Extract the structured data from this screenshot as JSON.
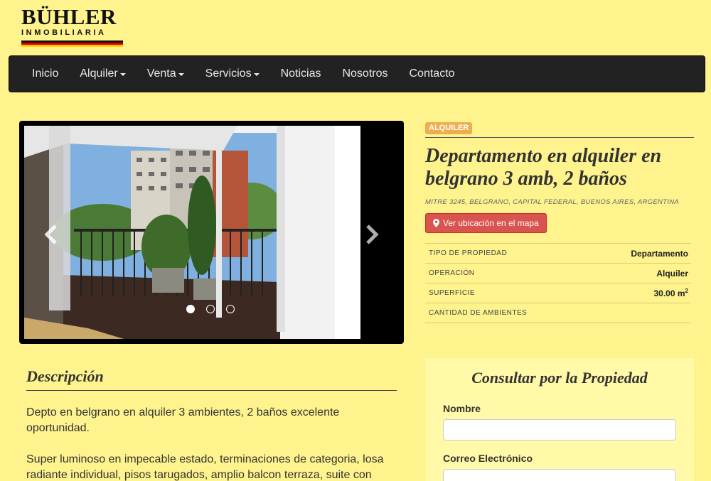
{
  "brand": {
    "name": "BÜHLER",
    "subtitle": "INMOBILIARIA",
    "flag_colors": [
      "#111111",
      "#dd0000",
      "#ffce00"
    ]
  },
  "nav": {
    "items": [
      {
        "label": "Inicio",
        "dropdown": false
      },
      {
        "label": "Alquiler",
        "dropdown": true
      },
      {
        "label": "Venta",
        "dropdown": true
      },
      {
        "label": "Servicios",
        "dropdown": true
      },
      {
        "label": "Noticias",
        "dropdown": false
      },
      {
        "label": "Nosotros",
        "dropdown": false
      },
      {
        "label": "Contacto",
        "dropdown": false
      }
    ]
  },
  "carousel": {
    "prev_icon": "chevron-left-icon",
    "next_icon": "chevron-right-icon",
    "slide_count": 3,
    "active_slide": 1
  },
  "property": {
    "badge": "ALQUILER",
    "title": "Departamento en alquiler en belgrano 3 amb, 2 baños",
    "address": "MITRE 3245, BELGRANO, CAPITAL FEDERAL, BUENOS AIRES, ARGENTINA",
    "map_button": "Ver ubicación en el mapa",
    "details": [
      {
        "key": "TIPO DE PROPIEDAD",
        "value": "Departamento"
      },
      {
        "key": "OPERACIÓN",
        "value": "Alquiler"
      },
      {
        "key": "SUPERFICIE",
        "value": "30.00 m²"
      },
      {
        "key": "CANTIDAD DE AMBIENTES",
        "value": ""
      }
    ]
  },
  "description": {
    "title": "Descripción",
    "paragraphs": [
      "Depto en belgrano en alquiler 3 ambientes, 2 baños excelente oportunidad.",
      "Super luminoso en impecable estado, terminaciones de categoria, losa radiante individual, pisos tarugados, amplio balcon terraza, suite con"
    ]
  },
  "contact_form": {
    "title": "Consultar por la Propiedad",
    "fields": [
      {
        "label": "Nombre",
        "value": ""
      },
      {
        "label": "Correo Electrónico",
        "value": ""
      }
    ]
  },
  "colors": {
    "page_bg": "#fef38d",
    "navbar_bg": "#222222",
    "badge": "#f0ad4e",
    "map_button": "#d9534f",
    "form_bg": "#fff9a8"
  }
}
